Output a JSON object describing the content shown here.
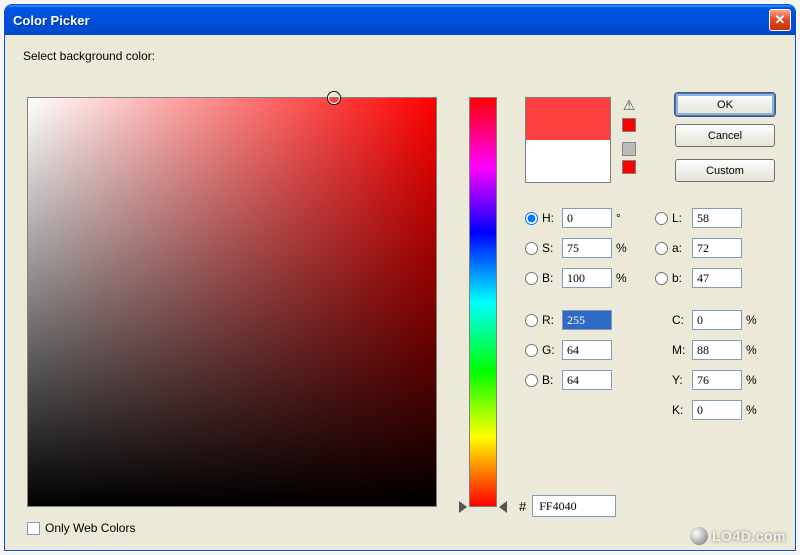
{
  "title": "Color Picker",
  "instruction": "Select background color:",
  "buttons": {
    "ok": "OK",
    "cancel": "Cancel",
    "custom": "Custom"
  },
  "preview": {
    "new_color": "#ff4040",
    "old_color": "#ffffff"
  },
  "hsb": {
    "h": {
      "label": "H:",
      "value": "0",
      "unit": "°"
    },
    "s": {
      "label": "S:",
      "value": "75",
      "unit": "%"
    },
    "b": {
      "label": "B:",
      "value": "100",
      "unit": "%"
    }
  },
  "lab": {
    "l": {
      "label": "L:",
      "value": "58"
    },
    "a": {
      "label": "a:",
      "value": "72"
    },
    "b": {
      "label": "b:",
      "value": "47"
    }
  },
  "rgb": {
    "r": {
      "label": "R:",
      "value": "255"
    },
    "g": {
      "label": "G:",
      "value": "64"
    },
    "b": {
      "label": "B:",
      "value": "64"
    }
  },
  "cmyk": {
    "c": {
      "label": "C:",
      "value": "0",
      "unit": "%"
    },
    "m": {
      "label": "M:",
      "value": "88",
      "unit": "%"
    },
    "y": {
      "label": "Y:",
      "value": "76",
      "unit": "%"
    },
    "k": {
      "label": "K:",
      "value": "0",
      "unit": "%"
    }
  },
  "hex": {
    "label": "#",
    "value": "FF4040"
  },
  "only_web_colors": {
    "label": "Only Web Colors",
    "checked": false
  },
  "selected_radio": "H",
  "watermark": "LO4D.com",
  "hue_slider_pos_pct": 100,
  "field_cursor": {
    "x_pct": 75,
    "y_pct": 0
  }
}
